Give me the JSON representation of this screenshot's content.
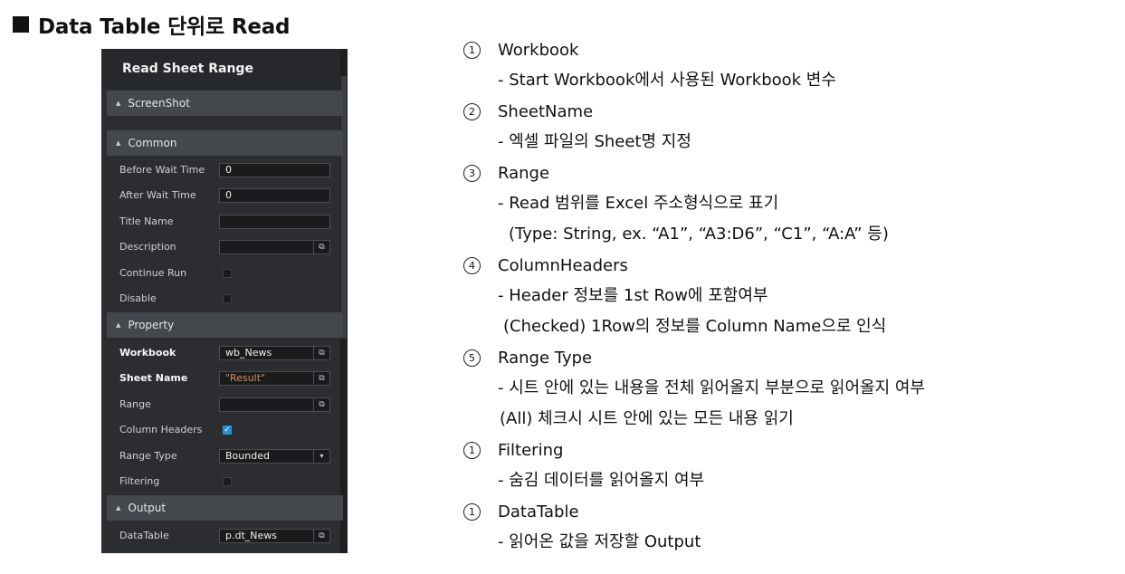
{
  "heading": "Data Table 단위로 Read",
  "panel": {
    "title": "Read Sheet Range",
    "sections": {
      "screenshot": "ScreenShot",
      "common": "Common",
      "property": "Property",
      "output": "Output"
    },
    "common_rows": [
      {
        "label": "Before Wait Time",
        "value": "0"
      },
      {
        "label": "After Wait Time",
        "value": "0"
      },
      {
        "label": "Title Name",
        "value": ""
      },
      {
        "label": "Description",
        "value": ""
      },
      {
        "label": "Continue Run",
        "checked": false
      },
      {
        "label": "Disable",
        "checked": false
      }
    ],
    "property_rows": [
      {
        "label": "Workbook",
        "value": "wb_News"
      },
      {
        "label": "Sheet Name",
        "value": "\"Result\""
      },
      {
        "label": "Range",
        "value": ""
      },
      {
        "label": "Column Headers",
        "checked": true
      },
      {
        "label": "Range Type",
        "value": "Bounded"
      },
      {
        "label": "Filtering",
        "checked": false
      }
    ],
    "output_rows": [
      {
        "label": "DataTable",
        "value": "p.dt_News"
      }
    ]
  },
  "items": [
    {
      "num": "1",
      "title": "Workbook",
      "lines": [
        "- Start Workbook에서 사용된 Workbook 변수"
      ]
    },
    {
      "num": "2",
      "title": "SheetName",
      "lines": [
        "- 엑셀 파일의 Sheet명 지정"
      ]
    },
    {
      "num": "3",
      "title": "Range",
      "lines": [
        "- Read 범위를 Excel 주소형식으로 표기",
        " (Type: String, ex. “A1”, “A3:D6”, “C1”, “A:A” 등)"
      ]
    },
    {
      "num": "4",
      "title": "ColumnHeaders",
      "lines": [
        "- Header 정보를 1st Row에 포함여부",
        "(Checked) 1Row의 정보를 Column Name으로 인식"
      ]
    },
    {
      "num": "5",
      "title": "Range Type",
      "lines": [
        " - 시트 안에 있는 내용을 전체 읽어올지 부분으로 읽어올지 여부",
        "(All) 체크시 시트 안에 있는 모든 내용 읽기"
      ]
    },
    {
      "num": "1",
      "title": "Filtering",
      "lines": [
        " - 숨김 데이터를 읽어올지 여부"
      ]
    },
    {
      "num": "1",
      "title": "DataTable",
      "lines": [
        " - 읽어온 값을 저장할 Output"
      ]
    }
  ]
}
